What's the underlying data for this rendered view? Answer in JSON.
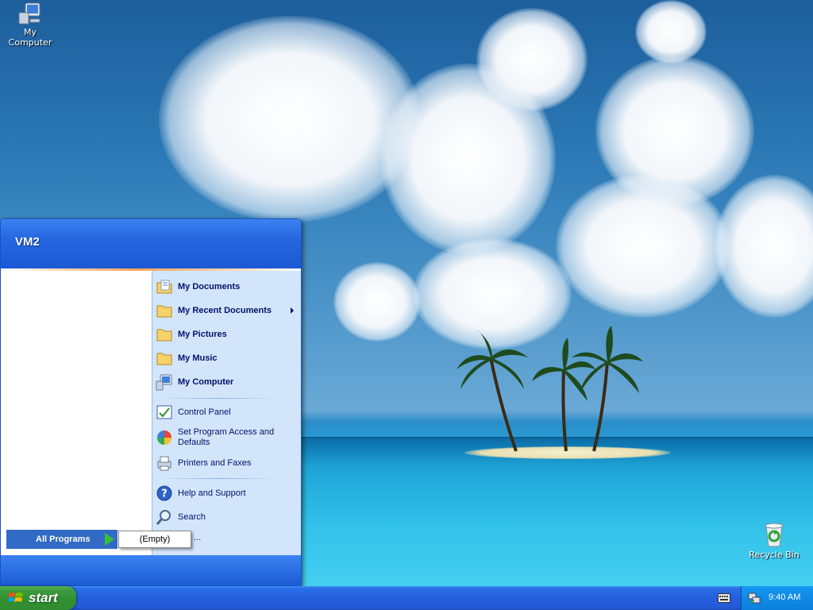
{
  "desktop": {
    "icons": [
      {
        "label": "My Computer"
      },
      {
        "label": "Recycle Bin"
      }
    ]
  },
  "start_menu": {
    "user": "VM2",
    "right_column": [
      {
        "label": "My Documents",
        "icon": "my-documents-icon",
        "bold": true
      },
      {
        "label": "My Recent Documents",
        "icon": "recent-documents-icon",
        "bold": true,
        "submenu": true
      },
      {
        "label": "My Pictures",
        "icon": "folder-icon",
        "bold": true
      },
      {
        "label": "My Music",
        "icon": "folder-icon",
        "bold": true
      },
      {
        "label": "My Computer",
        "icon": "computer-icon",
        "bold": true
      },
      {
        "label": "Control Panel",
        "icon": "control-panel-icon",
        "bold": false
      },
      {
        "label": "Set Program Access and Defaults",
        "icon": "program-access-icon",
        "bold": false
      },
      {
        "label": "Printers and Faxes",
        "icon": "printer-icon",
        "bold": false
      },
      {
        "label": "Help and Support",
        "icon": "help-icon",
        "bold": false
      },
      {
        "label": "Search",
        "icon": "search-icon",
        "bold": false
      }
    ],
    "all_programs": "All Programs",
    "submenu_empty": "(Empty)",
    "run_fragment": "..."
  },
  "taskbar": {
    "start_label": "start",
    "clock": "9:40 AM"
  },
  "colors": {
    "taskbar_blue": "#245edb",
    "start_green": "#3c9a3c",
    "tray_blue": "#0f8ae6",
    "menu_right_bg": "#d3e5fa"
  }
}
